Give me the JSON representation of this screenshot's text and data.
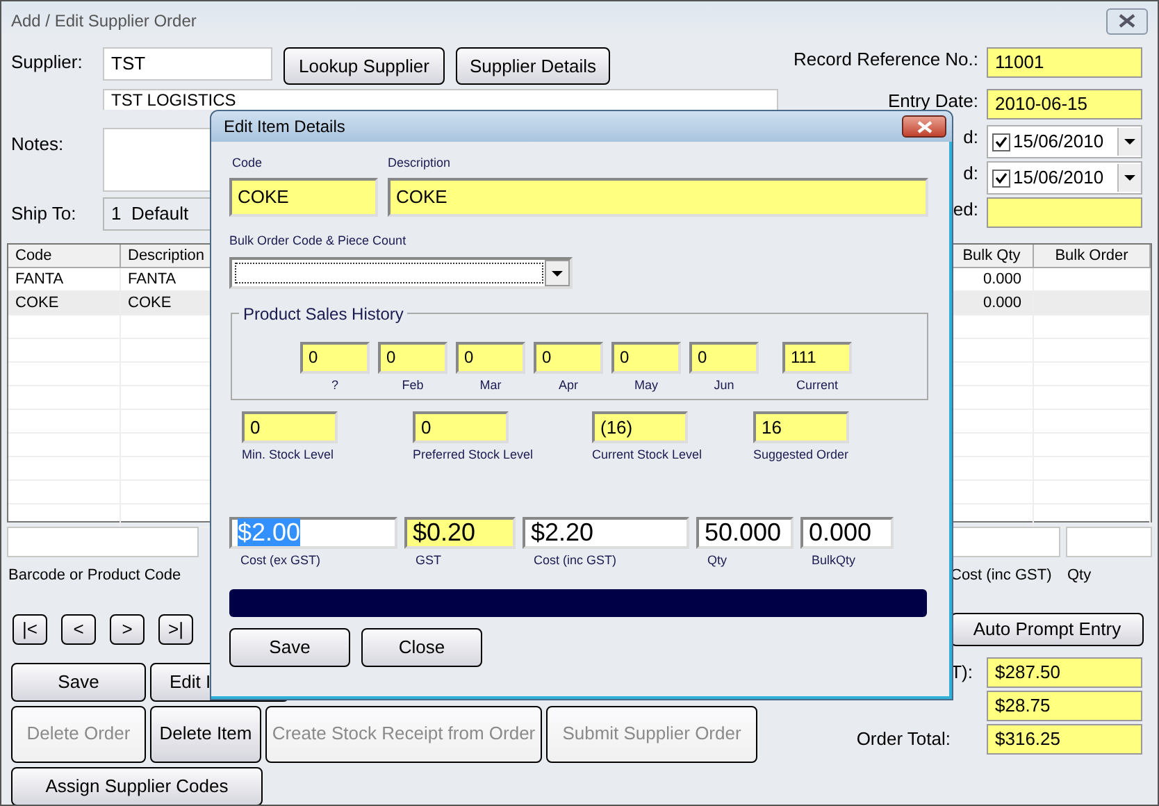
{
  "window": {
    "title": "Add / Edit Supplier Order"
  },
  "supplier": {
    "label": "Supplier:",
    "code": "TST",
    "name": "TST LOGISTICS"
  },
  "supplier_buttons": [
    "Lookup Supplier",
    "Supplier Details"
  ],
  "notes": {
    "label": "Notes:"
  },
  "ship_to": {
    "label": "Ship To:",
    "value": "1  Default"
  },
  "header_fields": [
    {
      "kind": "text",
      "label": "Record Reference No.:",
      "value": "11001"
    },
    {
      "kind": "text",
      "label": "Entry Date:",
      "value": "2010-06-15"
    },
    {
      "kind": "date",
      "label": "d:",
      "value": "15/06/2010",
      "checked": true
    },
    {
      "kind": "date",
      "label": "d:",
      "value": "15/06/2010",
      "checked": true
    },
    {
      "kind": "text",
      "label": "ed:"
    }
  ],
  "items_table": {
    "columns": [
      "Code",
      "Description",
      "Bulk Qty",
      "Bulk Order"
    ],
    "rows": [
      {
        "code": "FANTA",
        "description": "FANTA",
        "bulk_qty": "0.000",
        "selected": false
      },
      {
        "code": "COKE",
        "description": "COKE",
        "bulk_qty": "0.000",
        "selected": true
      }
    ]
  },
  "entry_row": {
    "labels": [
      "Barcode or Product Code",
      "Cost (inc GST)",
      "Qty"
    ]
  },
  "nav_buttons": [
    "|<",
    "<",
    ">",
    ">|"
  ],
  "auto_prompt_button": "Auto Prompt Entry",
  "action_buttons": [
    {
      "label": "Save",
      "disabled": false
    },
    {
      "label": "Edit I",
      "disabled": false
    },
    {
      "label": "Delete Order",
      "disabled": true
    },
    {
      "label": "Delete Item",
      "disabled": false
    },
    {
      "label": "Create Stock Receipt from Order",
      "disabled": true
    },
    {
      "label": "Submit Supplier Order",
      "disabled": true
    },
    {
      "label": "Assign Supplier Codes",
      "disabled": false
    }
  ],
  "totals": [
    {
      "label": "T):",
      "value": "$287.50"
    },
    {
      "value": "$28.75"
    },
    {
      "label": "Order Total:",
      "value": "$316.25"
    }
  ],
  "dialog": {
    "title": "Edit Item Details",
    "code": {
      "label": "Code",
      "value": "COKE"
    },
    "description": {
      "label": "Description",
      "value": "COKE"
    },
    "bulk_order": {
      "label": "Bulk Order Code & Piece Count"
    },
    "sales_history": {
      "title": "Product Sales History",
      "months": [
        {
          "label": "?",
          "value": "0"
        },
        {
          "label": "Feb",
          "value": "0"
        },
        {
          "label": "Mar",
          "value": "0"
        },
        {
          "label": "Apr",
          "value": "0"
        },
        {
          "label": "May",
          "value": "0"
        },
        {
          "label": "Jun",
          "value": "0"
        },
        {
          "label": "Current",
          "value": "111"
        }
      ]
    },
    "stock": [
      {
        "label": "Min. Stock Level",
        "value": "0"
      },
      {
        "label": "Preferred Stock Level",
        "value": "0"
      },
      {
        "label": "Current Stock Level",
        "value": "(16)"
      },
      {
        "label": "Suggested Order",
        "value": "16"
      }
    ],
    "costs": [
      {
        "label": "Cost (ex GST)",
        "value": "$2.00",
        "readonly": false,
        "text_selected": true
      },
      {
        "label": "GST",
        "value": "$0.20",
        "readonly": true,
        "text_selected": false
      },
      {
        "label": "Cost (inc GST)",
        "value": "$2.20",
        "readonly": false,
        "text_selected": false
      },
      {
        "label": "Qty",
        "value": "50.000",
        "readonly": false,
        "text_selected": false
      },
      {
        "label": "BulkQty",
        "value": "0.000",
        "readonly": false,
        "text_selected": false
      }
    ],
    "buttons": [
      "Save",
      "Close"
    ]
  }
}
